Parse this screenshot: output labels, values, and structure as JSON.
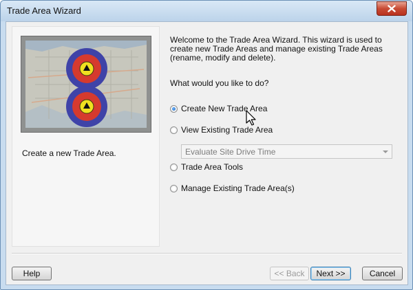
{
  "window": {
    "title": "Trade Area Wizard",
    "close_icon": "close-icon"
  },
  "left_panel": {
    "image_icon": "trade-area-map-icon",
    "description": "Create a new Trade Area."
  },
  "right_panel": {
    "intro": "Welcome to the Trade Area Wizard. This wizard is used to create new Trade Areas and manage existing Trade Areas (rename, modify and delete).",
    "question": "What would you like to do?",
    "options": [
      {
        "label": "Create New Trade Area",
        "checked": true
      },
      {
        "label": "View Existing Trade Area",
        "checked": false
      },
      {
        "label": "Trade Area Tools",
        "checked": false
      },
      {
        "label": "Manage Existing Trade Area(s)",
        "checked": false
      }
    ],
    "dropdown": {
      "value": "Evaluate Site Drive Time",
      "enabled": false
    }
  },
  "buttons": {
    "help": "Help",
    "back": "<< Back",
    "next": "Next >>",
    "cancel": "Cancel"
  },
  "colors": {
    "accent": "#1660b8",
    "ring_blue": "#3f43a8",
    "ring_red": "#d63a2e",
    "ring_yellow": "#f0e020"
  }
}
